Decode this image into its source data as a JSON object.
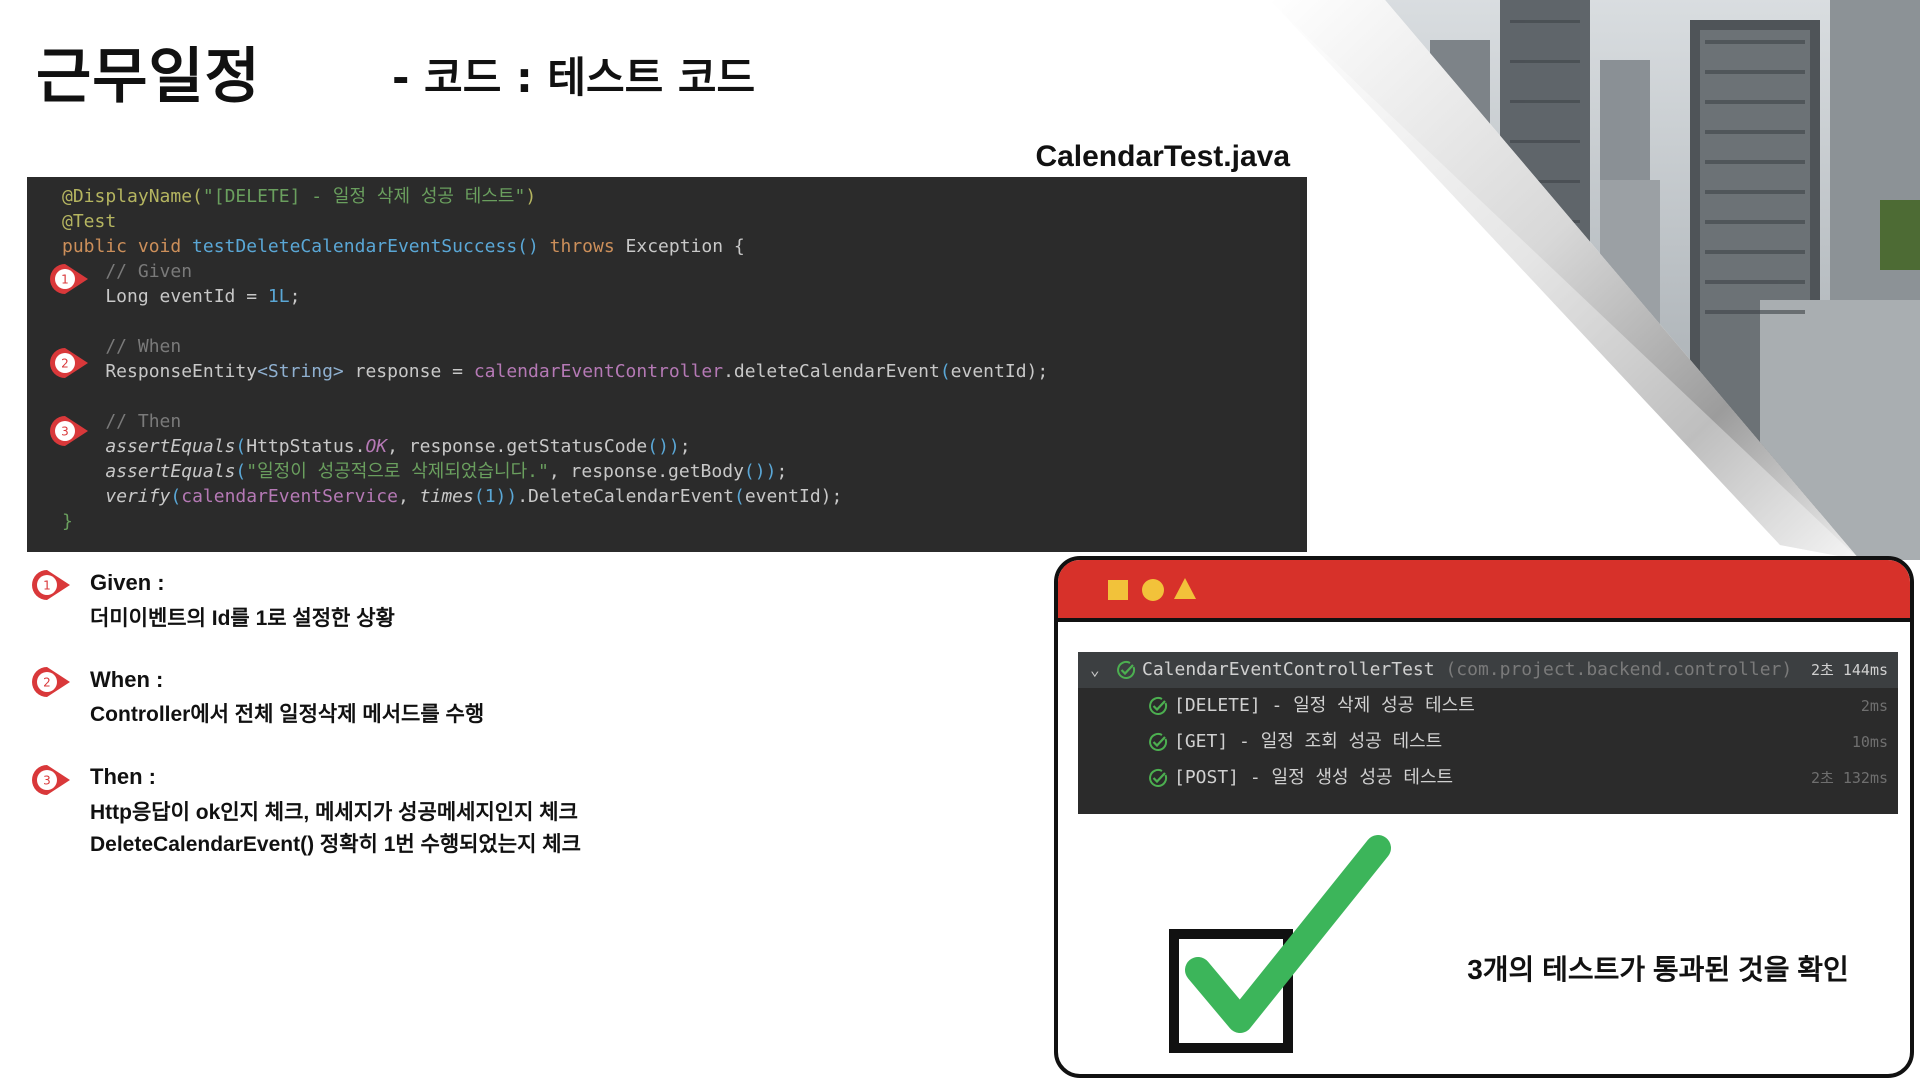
{
  "header": {
    "title": "근무일정",
    "subtitle": "- 코드 : 테스트 코드"
  },
  "file_name": "CalendarTest.java",
  "code": {
    "lines": [
      {
        "parts": [
          {
            "t": "@DisplayName(",
            "c": "c-ann"
          },
          {
            "t": "\"[DELETE] - 일정 삭제 성공 테스트\"",
            "c": "c-str"
          },
          {
            "t": ")",
            "c": "c-ann"
          }
        ]
      },
      {
        "parts": [
          {
            "t": "@Test",
            "c": "c-ann"
          }
        ]
      },
      {
        "parts": [
          {
            "t": "public void ",
            "c": "c-kw"
          },
          {
            "t": "testDeleteCalendarEventSuccess",
            "c": "c-fn"
          },
          {
            "t": "() ",
            "c": "c-par"
          },
          {
            "t": "throws ",
            "c": "c-kw"
          },
          {
            "t": "Exception {",
            "c": ""
          }
        ]
      },
      {
        "parts": [
          {
            "t": "    // Given",
            "c": "c-com"
          }
        ]
      },
      {
        "parts": [
          {
            "t": "    Long eventId = ",
            "c": ""
          },
          {
            "t": "1L",
            "c": "c-num"
          },
          {
            "t": ";",
            "c": ""
          }
        ]
      },
      {
        "parts": [
          {
            "t": "",
            "c": ""
          }
        ]
      },
      {
        "parts": [
          {
            "t": "    // When",
            "c": "c-com"
          }
        ]
      },
      {
        "parts": [
          {
            "t": "    ResponseEntity",
            "c": ""
          },
          {
            "t": "<String>",
            "c": "c-gen"
          },
          {
            "t": " response = ",
            "c": ""
          },
          {
            "t": "calendarEventController",
            "c": "c-fld"
          },
          {
            "t": ".deleteCalendarEvent",
            "c": ""
          },
          {
            "t": "(",
            "c": "c-par"
          },
          {
            "t": "eventId",
            "c": ""
          },
          {
            "t": ");",
            "c": ""
          }
        ]
      },
      {
        "parts": [
          {
            "t": "",
            "c": ""
          }
        ]
      },
      {
        "parts": [
          {
            "t": "    // Then",
            "c": "c-com"
          }
        ]
      },
      {
        "parts": [
          {
            "t": "    ",
            "c": ""
          },
          {
            "t": "assertEquals",
            "c": "c-ital"
          },
          {
            "t": "(",
            "c": "c-par"
          },
          {
            "t": "HttpStatus.",
            "c": ""
          },
          {
            "t": "OK",
            "c": "c-const"
          },
          {
            "t": ", response.getStatusCode",
            "c": ""
          },
          {
            "t": "())",
            "c": "c-par"
          },
          {
            "t": ";",
            "c": ""
          }
        ]
      },
      {
        "parts": [
          {
            "t": "    ",
            "c": ""
          },
          {
            "t": "assertEquals",
            "c": "c-ital"
          },
          {
            "t": "(",
            "c": "c-par"
          },
          {
            "t": "\"일정이 성공적으로 삭제되었습니다.\"",
            "c": "c-str"
          },
          {
            "t": ", response.getBody",
            "c": ""
          },
          {
            "t": "())",
            "c": "c-par"
          },
          {
            "t": ";",
            "c": ""
          }
        ]
      },
      {
        "parts": [
          {
            "t": "    ",
            "c": ""
          },
          {
            "t": "verify",
            "c": "c-ital"
          },
          {
            "t": "(",
            "c": "c-par"
          },
          {
            "t": "calendarEventService",
            "c": "c-fld"
          },
          {
            "t": ", ",
            "c": ""
          },
          {
            "t": "times",
            "c": "c-ital"
          },
          {
            "t": "(1))",
            "c": "c-par"
          },
          {
            "t": ".DeleteCalendarEvent",
            "c": ""
          },
          {
            "t": "(",
            "c": "c-par"
          },
          {
            "t": "eventId",
            "c": ""
          },
          {
            "t": ");",
            "c": ""
          }
        ]
      },
      {
        "parts": [
          {
            "t": "}",
            "c": "c-str"
          }
        ]
      }
    ]
  },
  "steps": [
    {
      "num": "1",
      "head": "Given :",
      "lines": [
        "더미이벤트의 Id를 1로 설정한 상황"
      ]
    },
    {
      "num": "2",
      "head": "When :",
      "lines": [
        "Controller에서 전체 일정삭제 메서드를 수행"
      ]
    },
    {
      "num": "3",
      "head": "Then :",
      "lines": [
        "Http응답이 ok인지 체크, 메세지가 성공메세지인지 체크",
        "DeleteCalendarEvent() 정확히 1번 수행되었는지 체크"
      ]
    }
  ],
  "test_results": {
    "suite": {
      "name": "CalendarEventControllerTest",
      "package": "(com.project.backend.controller)",
      "time": "2초 144ms"
    },
    "tests": [
      {
        "name": "[DELETE] - 일정 삭제 성공 테스트",
        "time": "2ms"
      },
      {
        "name": "[GET] - 일정 조회 성공 테스트",
        "time": "10ms"
      },
      {
        "name": "[POST] - 일정 생성 성공 테스트",
        "time": "2초 132ms"
      }
    ]
  },
  "pass_message": "3개의  테스트가 통과된 것을 확인",
  "colors": {
    "accent_red": "#d7312a",
    "pass_green": "#3cb55a",
    "marker_red": "#d9383a"
  },
  "icons": [
    "check-circle-icon",
    "chevron-down-icon",
    "square-icon",
    "circle-icon",
    "triangle-icon",
    "checkbox-check-icon",
    "step-marker-icon"
  ]
}
